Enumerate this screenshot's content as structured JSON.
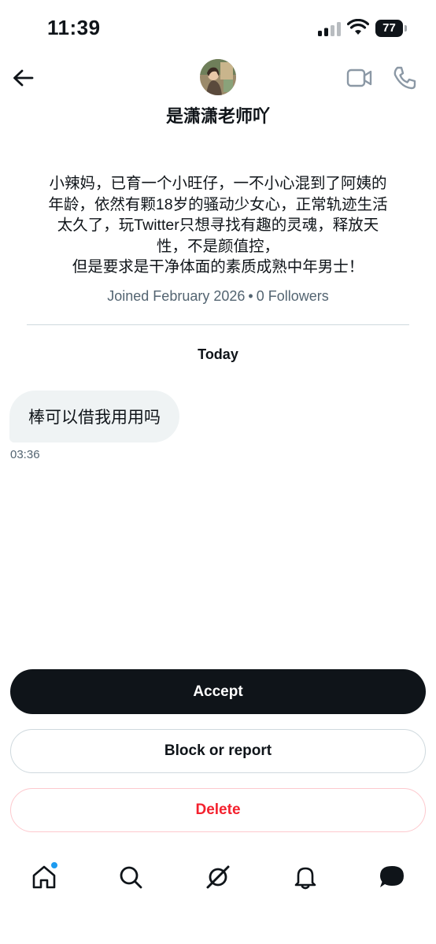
{
  "status_bar": {
    "time": "11:39",
    "battery": "77"
  },
  "header": {
    "display_name": "是潇潇老师吖"
  },
  "profile": {
    "bio_lines": [
      "小辣妈，已育一个小旺仔，一不小心混到了阿姨的",
      "年龄，依然有颗18岁的骚动少女心，正常轨迹生活",
      "太久了，玩Twitter只想寻找有趣的灵魂，释放天",
      "性，不是颜值控，",
      "但是要求是干净体面的素质成熟中年男士！"
    ],
    "joined": "Joined February 2026",
    "separator": "•",
    "followers": "0 Followers"
  },
  "conversation": {
    "date_header": "Today",
    "messages": [
      {
        "text": "棒可以借我用用吗",
        "time": "03:36"
      }
    ]
  },
  "actions": {
    "accept": "Accept",
    "block_or_report": "Block or report",
    "delete": "Delete"
  },
  "nav": {
    "items": [
      "home-icon",
      "search-icon",
      "grok-icon",
      "notifications-icon",
      "messages-icon"
    ],
    "home_has_badge": true
  },
  "colors": {
    "text_primary": "#0f1419",
    "text_secondary": "#536471",
    "accent_blue": "#1d9bf0",
    "delete_red": "#f4212e",
    "bubble_bg": "#eff3f4"
  }
}
